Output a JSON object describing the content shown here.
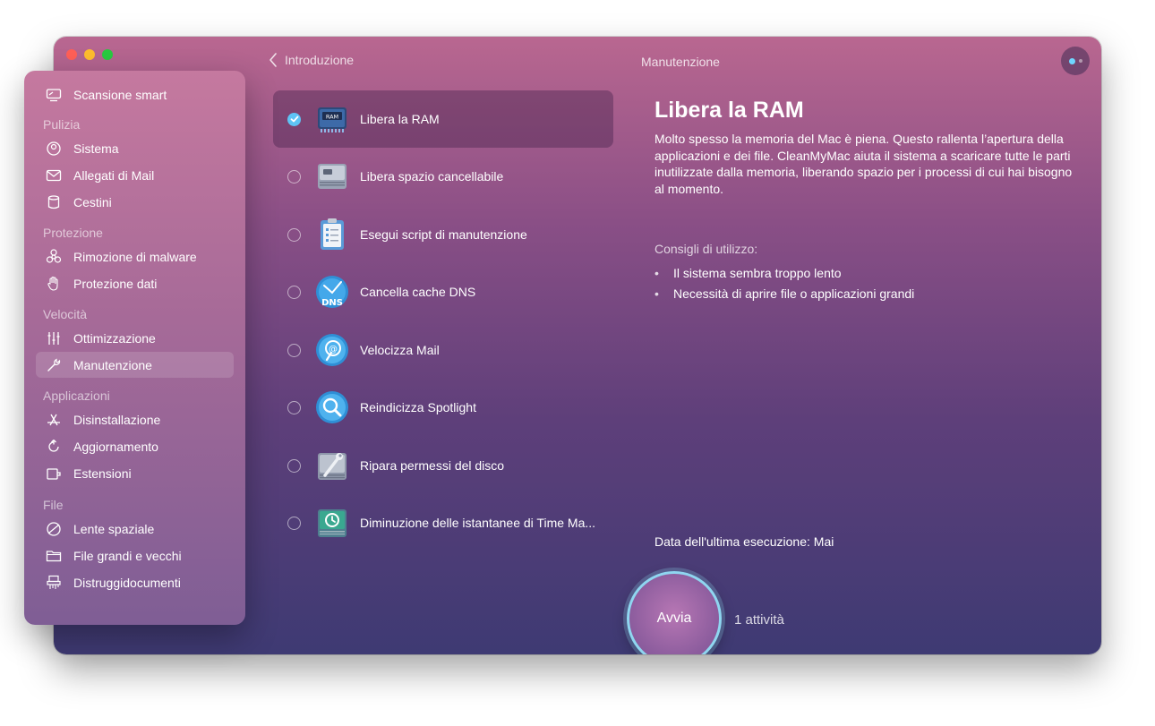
{
  "window": {
    "back_label": "Introduzione",
    "title": "Manutenzione"
  },
  "sidebar": {
    "smart_scan": "Scansione smart",
    "sections": [
      {
        "header": "Pulizia",
        "items": [
          "Sistema",
          "Allegati di Mail",
          "Cestini"
        ]
      },
      {
        "header": "Protezione",
        "items": [
          "Rimozione di malware",
          "Protezione dati"
        ]
      },
      {
        "header": "Velocità",
        "items": [
          "Ottimizzazione",
          "Manutenzione"
        ]
      },
      {
        "header": "Applicazioni",
        "items": [
          "Disinstallazione",
          "Aggiornamento",
          "Estensioni"
        ]
      },
      {
        "header": "File",
        "items": [
          "Lente spaziale",
          "File grandi e vecchi",
          "Distruggidocumenti"
        ]
      }
    ],
    "active_item": "Manutenzione"
  },
  "tasks": [
    {
      "label": "Libera la RAM",
      "icon": "ram-chip-icon",
      "checked": true
    },
    {
      "label": "Libera spazio cancellabile",
      "icon": "hard-drive-icon",
      "checked": false
    },
    {
      "label": "Esegui script di manutenzione",
      "icon": "clipboard-checklist-icon",
      "checked": false
    },
    {
      "label": "Cancella cache DNS",
      "icon": "dns-gauge-icon",
      "checked": false
    },
    {
      "label": "Velocizza Mail",
      "icon": "mail-speed-icon",
      "checked": false
    },
    {
      "label": "Reindicizza Spotlight",
      "icon": "magnifier-icon",
      "checked": false
    },
    {
      "label": "Ripara permessi del disco",
      "icon": "disk-wrench-icon",
      "checked": false
    },
    {
      "label": "Diminuzione delle istantanee di Time Ma...",
      "icon": "time-machine-disk-icon",
      "checked": false
    }
  ],
  "detail": {
    "title": "Libera la RAM",
    "description": "Molto spesso la memoria del Mac è piena. Questo rallenta l’apertura della applicazioni e dei file. CleanMyMac aiuta il sistema a scaricare tutte le parti inutilizzate dalla memoria, liberando spazio per i processi di cui hai bisogno al momento.",
    "tips_heading": "Consigli di utilizzo:",
    "tips": [
      "Il sistema sembra troppo lento",
      "Necessità di aprire file o applicazioni grandi"
    ],
    "bullet": "•",
    "last_run_label": "Data dell'ultima esecuzione:",
    "last_run_value": "Mai"
  },
  "footer": {
    "run_label": "Avvia",
    "activity_count": "1 attività"
  },
  "colors": {
    "accent_blue": "#5ec4f5",
    "ring": "#8fd6f0",
    "close": "#ff5f57",
    "minimize": "#febc2e",
    "zoom": "#28c840"
  }
}
